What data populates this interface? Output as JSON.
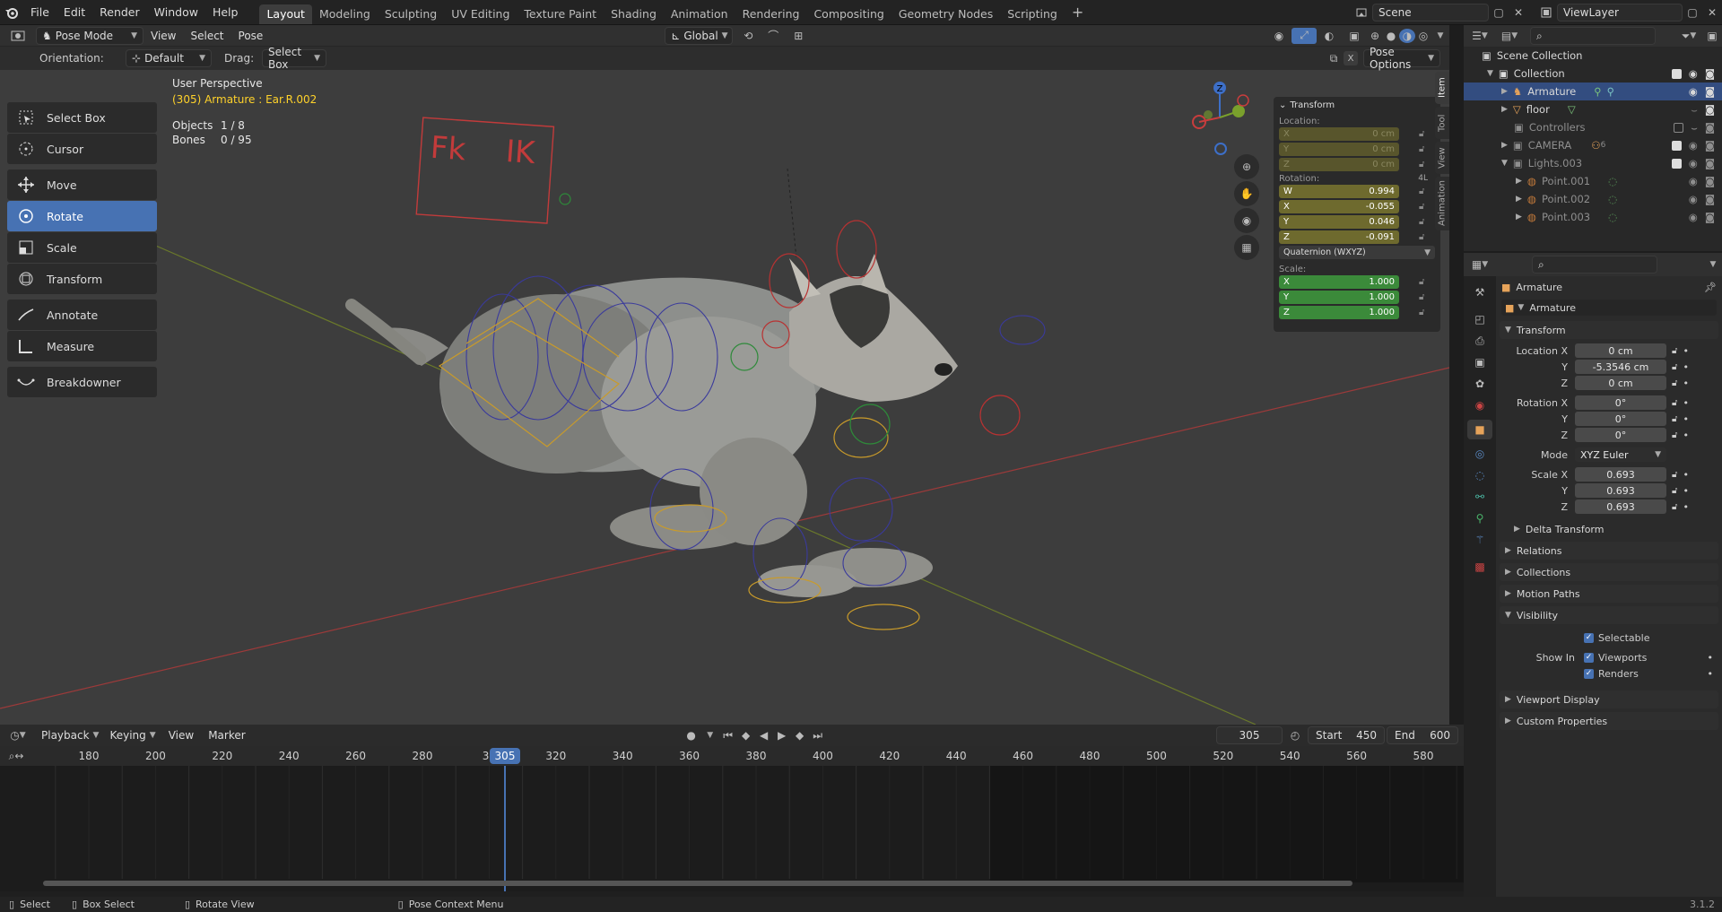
{
  "menu": {
    "file": "File",
    "edit": "Edit",
    "render": "Render",
    "window": "Window",
    "help": "Help"
  },
  "workspaces": [
    "Layout",
    "Modeling",
    "Sculpting",
    "UV Editing",
    "Texture Paint",
    "Shading",
    "Animation",
    "Rendering",
    "Compositing",
    "Geometry Nodes",
    "Scripting"
  ],
  "scene": {
    "name": "Scene",
    "view_layer": "ViewLayer"
  },
  "viewport_header": {
    "mode": "Pose Mode",
    "view": "View",
    "select": "Select",
    "pose": "Pose",
    "transform_orientation": "Global"
  },
  "tool_header": {
    "orientation_label": "Orientation:",
    "orientation_value": "Default",
    "drag_label": "Drag:",
    "drag_value": "Select Box",
    "pose_options": "Pose Options"
  },
  "toolbar": [
    "Select Box",
    "Cursor",
    "Move",
    "Rotate",
    "Scale",
    "Transform",
    "Annotate",
    "Measure",
    "Breakdowner"
  ],
  "overlay": {
    "perspective": "User Perspective",
    "active": "(305) Armature : Ear.R.002",
    "objects_label": "Objects",
    "objects_value": "1 / 8",
    "bones_label": "Bones",
    "bones_value": "0 / 95",
    "fk": "Fk",
    "ik": "IK"
  },
  "npanel": {
    "title": "Transform",
    "location_label": "Location:",
    "location": [
      "0 cm",
      "0 cm",
      "0 cm"
    ],
    "rotation_label": "Rotation:",
    "rotation_mode_badge": "4L",
    "rotation": [
      {
        "axis": "W",
        "value": "0.994"
      },
      {
        "axis": "X",
        "value": "-0.055"
      },
      {
        "axis": "Y",
        "value": "0.046"
      },
      {
        "axis": "Z",
        "value": "-0.091"
      }
    ],
    "rotation_mode": "Quaternion (WXYZ)",
    "scale_label": "Scale:",
    "scale": [
      "1.000",
      "1.000",
      "1.000"
    ],
    "tabs": [
      "Item",
      "Tool",
      "View",
      "Animation"
    ]
  },
  "timeline": {
    "playback": "Playback",
    "keying": "Keying",
    "view": "View",
    "marker": "Marker",
    "current_frame": "305",
    "start_label": "Start",
    "start": "450",
    "end_label": "End",
    "end": "600",
    "ticks": [
      "180",
      "200",
      "220",
      "240",
      "260",
      "280",
      "30",
      "320",
      "340",
      "360",
      "380",
      "400",
      "420",
      "440",
      "460",
      "480",
      "500",
      "520",
      "540",
      "560",
      "580"
    ],
    "playhead": "305"
  },
  "status": {
    "select": "Select",
    "box_select": "Box Select",
    "rotate_view": "Rotate View",
    "context": "Pose Context Menu",
    "version": "3.1.2"
  },
  "outliner": {
    "root": "Scene Collection",
    "rows": [
      {
        "name": "Collection"
      },
      {
        "name": "Armature"
      },
      {
        "name": "floor"
      },
      {
        "name": "Controllers"
      },
      {
        "name": "CAMERA",
        "badge": "6"
      },
      {
        "name": "Lights.003"
      },
      {
        "name": "Point.001"
      },
      {
        "name": "Point.002"
      },
      {
        "name": "Point.003"
      }
    ]
  },
  "properties": {
    "object_name": "Armature",
    "data_name": "Armature",
    "transform": "Transform",
    "location_label": "Location X",
    "location": [
      "0 cm",
      "-5.3546 cm",
      "0 cm"
    ],
    "rotation_label": "Rotation X",
    "rotation": [
      "0°",
      "0°",
      "0°"
    ],
    "mode_label": "Mode",
    "mode": "XYZ Euler",
    "scale_label": "Scale X",
    "scale": [
      "0.693",
      "0.693",
      "0.693"
    ],
    "axis_y": "Y",
    "axis_z": "Z",
    "delta": "Delta Transform",
    "relations": "Relations",
    "collections": "Collections",
    "motion_paths": "Motion Paths",
    "visibility": "Visibility",
    "selectable": "Selectable",
    "show_in": "Show In",
    "viewports": "Viewports",
    "renders": "Renders",
    "viewport_display": "Viewport Display",
    "custom_properties": "Custom Properties"
  },
  "colors": {
    "accent": "#4772b3",
    "selected_row": "#334d80",
    "location_field": "#6e6a2e",
    "scale_field": "#3b8a3a",
    "active_text": "#ffd22a"
  }
}
